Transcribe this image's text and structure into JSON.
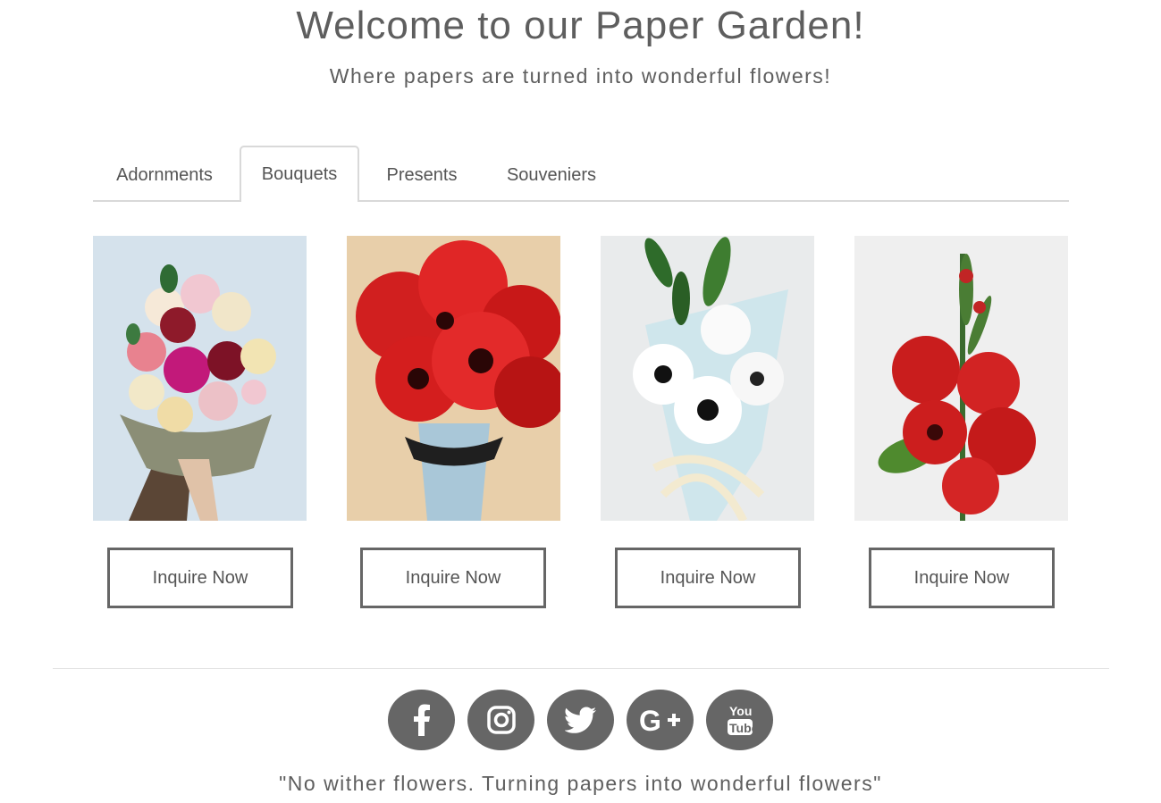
{
  "hero": {
    "title": "Welcome to our Paper Garden!",
    "subtitle": "Where papers are turned into wonderful flowers!"
  },
  "tabs": [
    {
      "label": "Adornments",
      "active": false
    },
    {
      "label": "Bouquets",
      "active": true
    },
    {
      "label": "Presents",
      "active": false
    },
    {
      "label": "Souveniers",
      "active": false
    }
  ],
  "products": [
    {
      "image": "mixed-rose-bouquet-photo",
      "button_label": "Inquire Now"
    },
    {
      "image": "red-poppy-bouquet-photo",
      "button_label": "Inquire Now"
    },
    {
      "image": "white-anemone-bouquet-photo",
      "button_label": "Inquire Now"
    },
    {
      "image": "red-rose-stem-photo",
      "button_label": "Inquire Now"
    }
  ],
  "social": [
    {
      "icon": "facebook-icon"
    },
    {
      "icon": "instagram-icon"
    },
    {
      "icon": "twitter-icon"
    },
    {
      "icon": "google-plus-icon"
    },
    {
      "icon": "youtube-icon"
    }
  ],
  "footer": {
    "quote": "\"No wither flowers. Turning papers into wonderful flowers\""
  },
  "colors": {
    "text": "#5e5e5e",
    "button_border": "#666666",
    "social_bg": "#666666",
    "divider": "#d9d9d9"
  }
}
